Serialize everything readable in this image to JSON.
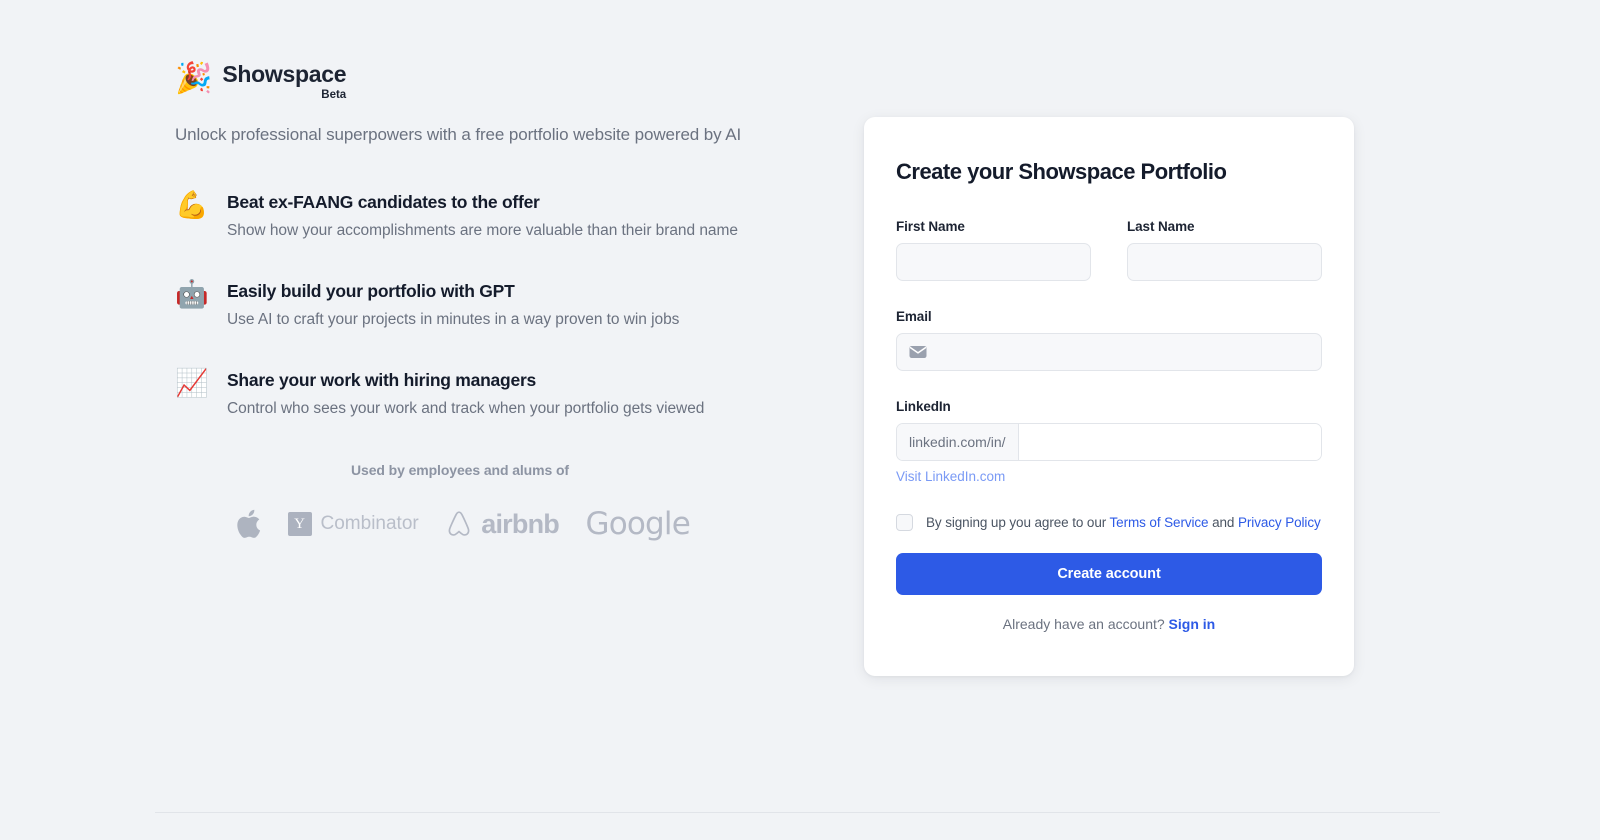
{
  "brand": {
    "emoji": "🎉",
    "emoji_name": "party-popper-icon",
    "name": "Showspace",
    "badge": "Beta"
  },
  "hero": {
    "tagline": "Unlock professional superpowers with a free portfolio website powered by AI"
  },
  "features": [
    {
      "emoji": "💪",
      "icon_name": "flexed-biceps-icon",
      "title": "Beat ex-FAANG candidates to the offer",
      "desc": "Show how your accomplishments are more valuable than their brand name"
    },
    {
      "emoji": "🤖",
      "icon_name": "robot-icon",
      "title": "Easily build your portfolio with GPT",
      "desc": "Use AI to craft your projects in minutes in a way proven to win jobs"
    },
    {
      "emoji": "📈",
      "icon_name": "chart-increasing-icon",
      "title": "Share your work with hiring managers",
      "desc": "Control who sees your work and track when your portfolio gets viewed"
    }
  ],
  "social_proof": {
    "title": "Used by employees and alums of",
    "logos": [
      {
        "name": "apple-logo",
        "label": "Apple"
      },
      {
        "name": "ycombinator-logo",
        "label": "Combinator",
        "mark": "Y"
      },
      {
        "name": "airbnb-logo",
        "label": "airbnb"
      },
      {
        "name": "google-logo",
        "label": "Google"
      }
    ]
  },
  "form": {
    "title": "Create your Showspace Portfolio",
    "first_name": {
      "label": "First Name",
      "value": "",
      "placeholder": ""
    },
    "last_name": {
      "label": "Last Name",
      "value": "",
      "placeholder": ""
    },
    "email": {
      "label": "Email",
      "value": "",
      "placeholder": "",
      "icon": "envelope-icon"
    },
    "linkedin": {
      "label": "LinkedIn",
      "prefix": "linkedin.com/in/",
      "value": "",
      "placeholder": "",
      "visit_link": "Visit LinkedIn.com"
    },
    "terms": {
      "checked": false,
      "prefix": "By signing up you agree to our ",
      "terms_label": "Terms of Service",
      "conjunction": " and ",
      "privacy_label": "Privacy Policy"
    },
    "submit_label": "Create account",
    "signin_prompt": "Already have an account?",
    "signin_label": "Sign in"
  },
  "colors": {
    "page_background": "#f1f3f6",
    "card_background": "#ffffff",
    "accent_blue": "#2d5ae6",
    "link_light_blue": "#7a9af5",
    "heading": "#141b2b",
    "muted_text": "#6b7280",
    "logo_gray": "#b4b9c5",
    "input_background": "#f7f8fa",
    "input_border": "#e2e5ea"
  }
}
